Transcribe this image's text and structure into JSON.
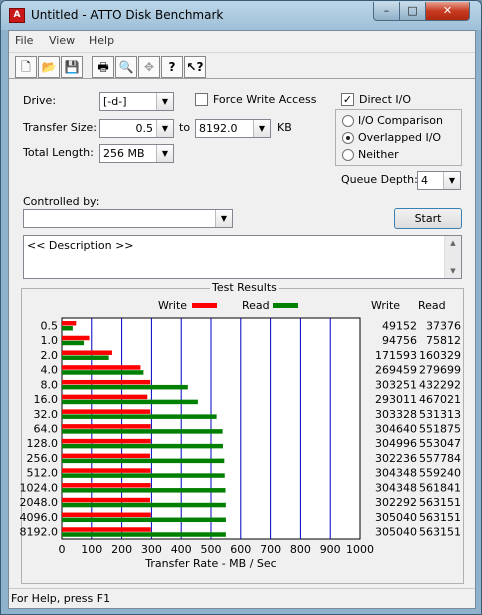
{
  "window": {
    "title": "Untitled - ATTO Disk Benchmark",
    "app_icon": "atto-app-icon",
    "controls": {
      "minimize": "–",
      "maximize": "□",
      "close": "✕"
    }
  },
  "menu": [
    "File",
    "View",
    "Help"
  ],
  "toolbar": [
    {
      "name": "new-icon",
      "glyph": "🗋"
    },
    {
      "name": "open-icon",
      "glyph": "📂"
    },
    {
      "name": "save-icon",
      "glyph": "💾"
    },
    {
      "name": "print-icon",
      "glyph": "🖶"
    },
    {
      "name": "print-preview-icon",
      "glyph": "🔍"
    },
    {
      "name": "move-icon",
      "glyph": "✥"
    },
    {
      "name": "about-icon",
      "glyph": "?"
    },
    {
      "name": "context-help-icon",
      "glyph": "↖?"
    }
  ],
  "settings": {
    "drive_label": "Drive:",
    "drive_value": "[-d-]",
    "force_write_access_label": "Force Write Access",
    "force_write_access_checked": false,
    "direct_io_label": "Direct I/O",
    "direct_io_checked": true,
    "transfer_size_label": "Transfer Size:",
    "transfer_from": "0.5",
    "to_label": "to",
    "transfer_to": "8192.0",
    "unit_label": "KB",
    "total_length_label": "Total Length:",
    "total_length_value": "256 MB",
    "io_modes": [
      {
        "label": "I/O Comparison",
        "selected": false
      },
      {
        "label": "Overlapped I/O",
        "selected": true
      },
      {
        "label": "Neither",
        "selected": false
      }
    ],
    "queue_depth_label": "Queue Depth:",
    "queue_depth_value": "4",
    "controlled_by_label": "Controlled by:",
    "controlled_by_value": "",
    "start_label": "Start",
    "description_text": "<< Description >>"
  },
  "results": {
    "group_title": "Test Results",
    "legend_write": "Write",
    "legend_read": "Read",
    "col_write": "Write",
    "col_read": "Read",
    "write_color": "#ff0000",
    "read_color": "#008000"
  },
  "chart_data": {
    "type": "bar",
    "orientation": "horizontal",
    "categories": [
      "0.5",
      "1.0",
      "2.0",
      "4.0",
      "8.0",
      "16.0",
      "32.0",
      "64.0",
      "128.0",
      "256.0",
      "512.0",
      "1024.0",
      "2048.0",
      "4096.0",
      "8192.0"
    ],
    "series": [
      {
        "name": "Write",
        "color": "#ff0000",
        "values": [
          49152,
          94756,
          171593,
          269459,
          303251,
          293011,
          303328,
          304640,
          304996,
          302236,
          304348,
          304348,
          302292,
          305040,
          305040
        ]
      },
      {
        "name": "Read",
        "color": "#008000",
        "values": [
          37376,
          75812,
          160329,
          279699,
          432292,
          467021,
          531313,
          551875,
          553047,
          557784,
          559240,
          561841,
          563151,
          563151,
          563151
        ]
      }
    ],
    "xlabel": "Transfer Rate - MB / Sec",
    "xlim": [
      0,
      1000
    ],
    "xticks": [
      0,
      100,
      200,
      300,
      400,
      500,
      600,
      700,
      800,
      900,
      1000
    ],
    "grid": true
  },
  "status": {
    "text": "For Help, press F1"
  }
}
